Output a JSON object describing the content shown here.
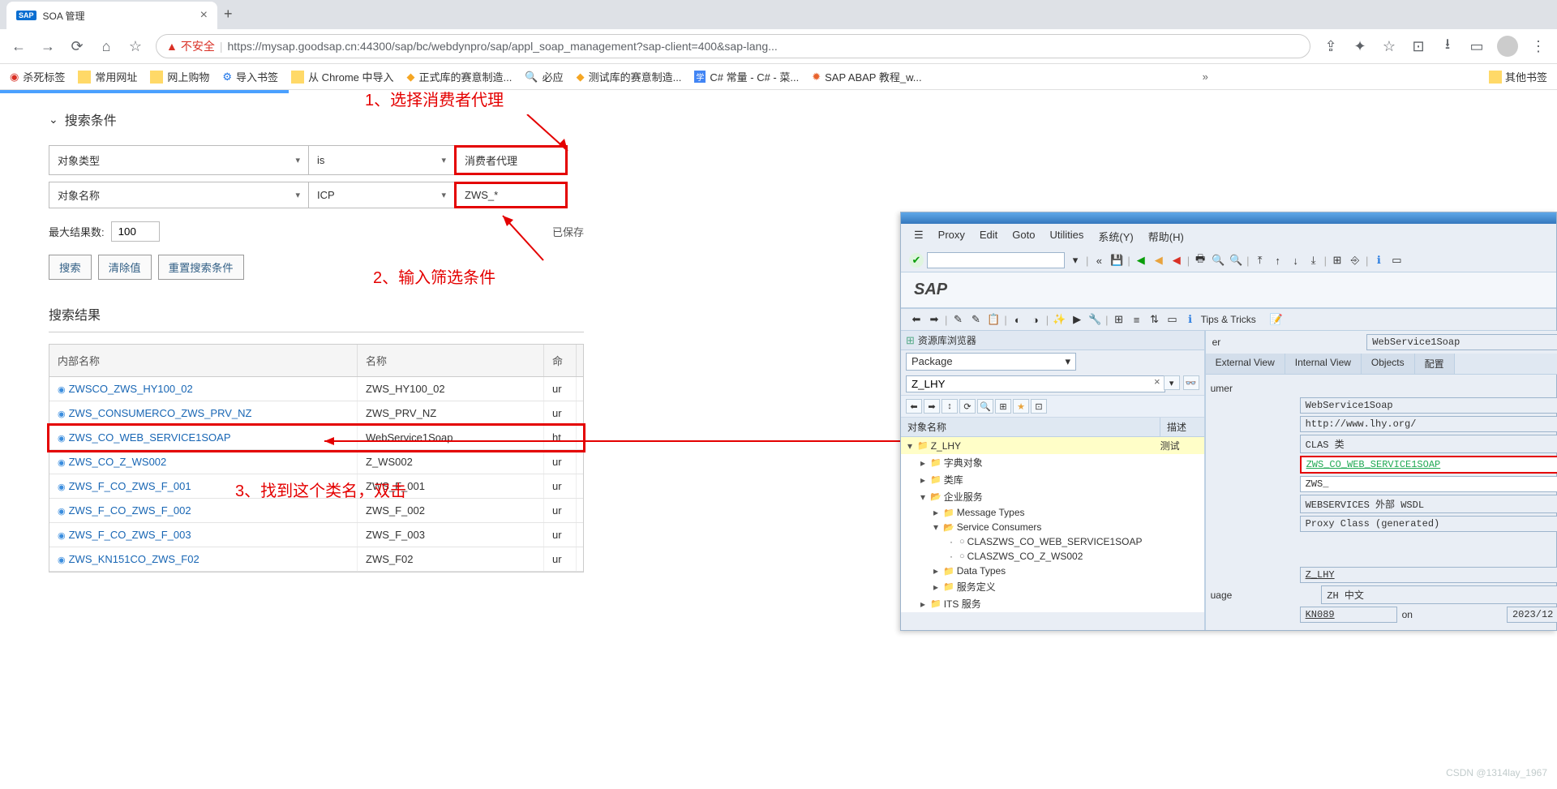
{
  "browser": {
    "tab_title": "SOA 管理",
    "url_unsafe": "不安全",
    "url": "https://mysap.goodsap.cn:44300/sap/bc/webdynpro/sap/appl_soap_management?sap-client=400&sap-lang...",
    "bookmarks": [
      "杀死标签",
      "常用网址",
      "网上购物",
      "导入书签",
      "从 Chrome 中导入",
      "正式库的赛意制造...",
      "必应",
      "测试库的赛意制造...",
      "C# 常量 - C# - 菜...",
      "SAP ABAP 教程_w..."
    ],
    "other_bookmarks": "其他书签"
  },
  "soa": {
    "section_search": "搜索条件",
    "row1": {
      "field": "对象类型",
      "op": "is",
      "val": "消费者代理"
    },
    "row2": {
      "field": "对象名称",
      "op": "ICP",
      "val": "ZWS_*"
    },
    "max_label": "最大结果数:",
    "max_value": "100",
    "saved": "已保存",
    "btn_search": "搜索",
    "btn_clear": "清除值",
    "btn_reset": "重置搜索条件",
    "results_title": "搜索结果",
    "cols": {
      "c1": "内部名称",
      "c2": "名称",
      "c3": "命"
    },
    "rows": [
      {
        "n": "ZWSCO_ZWS_HY100_02",
        "m": "ZWS_HY100_02",
        "t": "ur"
      },
      {
        "n": "ZWS_CONSUMERCO_ZWS_PRV_NZ",
        "m": "ZWS_PRV_NZ",
        "t": "ur"
      },
      {
        "n": "ZWS_CO_WEB_SERVICE1SOAP",
        "m": "WebService1Soap",
        "t": "ht"
      },
      {
        "n": "ZWS_CO_Z_WS002",
        "m": "Z_WS002",
        "t": "ur"
      },
      {
        "n": "ZWS_F_CO_ZWS_F_001",
        "m": "ZWS_F_001",
        "t": "ur"
      },
      {
        "n": "ZWS_F_CO_ZWS_F_002",
        "m": "ZWS_F_002",
        "t": "ur"
      },
      {
        "n": "ZWS_F_CO_ZWS_F_003",
        "m": "ZWS_F_003",
        "t": "ur"
      },
      {
        "n": "ZWS_KN151CO_ZWS_F02",
        "m": "ZWS_F02",
        "t": "ur"
      }
    ]
  },
  "anno": {
    "a1": "1、选择消费者代理",
    "a2": "2、输入筛选条件",
    "a3": "3、找到这个类名，双击"
  },
  "sap": {
    "menu": [
      "Proxy",
      "Edit",
      "Goto",
      "Utilities",
      "系统(Y)",
      "帮助(H)"
    ],
    "heading": "SAP",
    "tips": "Tips & Tricks",
    "browser_title": "资源库浏览器",
    "package_label": "Package",
    "package_value": "Z_LHY",
    "tree_head_name": "对象名称",
    "tree_head_desc": "描述",
    "tree": {
      "root": "Z_LHY",
      "root_desc": "测试",
      "n1": "字典对象",
      "n2": "类库",
      "n3": "企业服务",
      "n3a": "Message Types",
      "n3b": "Service Consumers",
      "sc1": "CLASZWS_CO_WEB_SERVICE1SOAP",
      "sc2": "CLASZWS_CO_Z_WS002",
      "n3c": "Data Types",
      "n3d": "服务定义",
      "n4": "ITS 服务"
    },
    "right": {
      "header_suffix": "er",
      "header_value": "WebService1Soap",
      "tabs": [
        "External View",
        "Internal View",
        "Objects",
        "配置"
      ],
      "umer": "umer",
      "v1": "WebService1Soap",
      "v2": "http://www.lhy.org/",
      "v3": "CLAS 类",
      "v4": "ZWS_CO_WEB_SERVICE1SOAP",
      "v5": "ZWS_",
      "v6": "WEBSERVICES 外部 WSDL",
      "v7": "Proxy Class (generated)",
      "pkg": "Z_LHY",
      "lang_lab": "uage",
      "lang": "ZH 中文",
      "user": "KN089",
      "on": "on",
      "date": "2023/12"
    }
  },
  "watermark": "CSDN @1314lay_1967"
}
